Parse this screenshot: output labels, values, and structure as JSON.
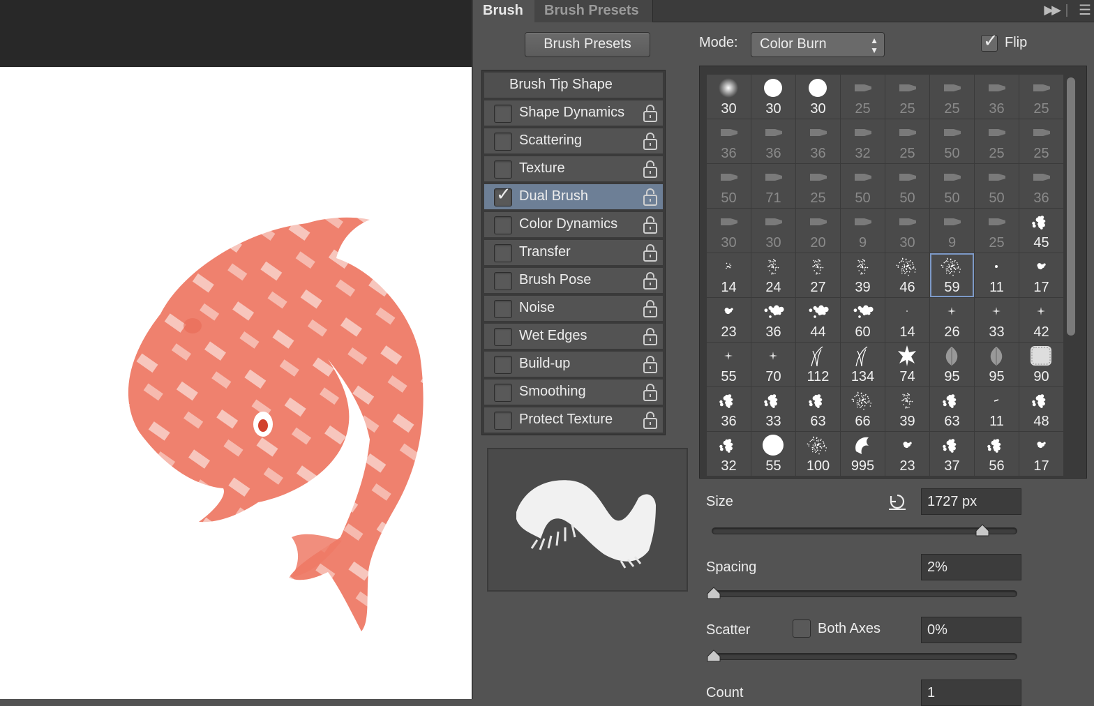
{
  "tabs": {
    "brush": "Brush",
    "brush_presets": "Brush Presets"
  },
  "toolbar": {
    "brush_presets_button": "Brush Presets",
    "mode_label": "Mode:",
    "mode_value": "Color Burn",
    "flip_label": "Flip",
    "flip_checked": true
  },
  "options": [
    {
      "label": "Brush Tip Shape",
      "header": true
    },
    {
      "label": "Shape Dynamics",
      "checked": false
    },
    {
      "label": "Scattering",
      "checked": false
    },
    {
      "label": "Texture",
      "checked": false
    },
    {
      "label": "Dual Brush",
      "checked": true,
      "active": true
    },
    {
      "label": "Color Dynamics",
      "checked": false
    },
    {
      "label": "Transfer",
      "checked": false
    },
    {
      "label": "Brush Pose",
      "checked": false
    },
    {
      "label": "Noise",
      "checked": false
    },
    {
      "label": "Wet Edges",
      "checked": false
    },
    {
      "label": "Build-up",
      "checked": false
    },
    {
      "label": "Smoothing",
      "checked": false
    },
    {
      "label": "Protect Texture",
      "checked": false
    }
  ],
  "brush_tips": [
    [
      {
        "n": "30",
        "i": "soft"
      },
      {
        "n": "30",
        "i": "hard"
      },
      {
        "n": "30",
        "i": "hard"
      },
      {
        "n": "25",
        "i": "tool",
        "d": true
      },
      {
        "n": "25",
        "i": "tool",
        "d": true
      },
      {
        "n": "25",
        "i": "tool",
        "d": true
      },
      {
        "n": "36",
        "i": "tool",
        "d": true
      },
      {
        "n": "25",
        "i": "tool",
        "d": true
      }
    ],
    [
      {
        "n": "36",
        "i": "tool",
        "d": true
      },
      {
        "n": "36",
        "i": "tool",
        "d": true
      },
      {
        "n": "36",
        "i": "tool",
        "d": true
      },
      {
        "n": "32",
        "i": "tool",
        "d": true
      },
      {
        "n": "25",
        "i": "tool",
        "d": true
      },
      {
        "n": "50",
        "i": "tool",
        "d": true
      },
      {
        "n": "25",
        "i": "tool",
        "d": true
      },
      {
        "n": "25",
        "i": "tool",
        "d": true
      }
    ],
    [
      {
        "n": "50",
        "i": "tool",
        "d": true
      },
      {
        "n": "71",
        "i": "tool",
        "d": true
      },
      {
        "n": "25",
        "i": "tool",
        "d": true
      },
      {
        "n": "50",
        "i": "tool",
        "d": true
      },
      {
        "n": "50",
        "i": "tool",
        "d": true
      },
      {
        "n": "50",
        "i": "tool",
        "d": true
      },
      {
        "n": "50",
        "i": "tool",
        "d": true
      },
      {
        "n": "36",
        "i": "tool",
        "d": true
      }
    ],
    [
      {
        "n": "30",
        "i": "tool",
        "d": true
      },
      {
        "n": "30",
        "i": "tool",
        "d": true
      },
      {
        "n": "20",
        "i": "tool",
        "d": true
      },
      {
        "n": "9",
        "i": "tool",
        "d": true
      },
      {
        "n": "30",
        "i": "tool",
        "d": true
      },
      {
        "n": "9",
        "i": "tool",
        "d": true
      },
      {
        "n": "25",
        "i": "tool",
        "d": true
      },
      {
        "n": "45",
        "i": "blob"
      }
    ],
    [
      {
        "n": "14",
        "i": "spat-s"
      },
      {
        "n": "24",
        "i": "spat"
      },
      {
        "n": "27",
        "i": "spat"
      },
      {
        "n": "39",
        "i": "spat"
      },
      {
        "n": "46",
        "i": "spat-l"
      },
      {
        "n": "59",
        "i": "spat-l",
        "sel": true
      },
      {
        "n": "11",
        "i": "dot"
      },
      {
        "n": "17",
        "i": "blob-s"
      }
    ],
    [
      {
        "n": "23",
        "i": "blob-s"
      },
      {
        "n": "36",
        "i": "chalk"
      },
      {
        "n": "44",
        "i": "chalk"
      },
      {
        "n": "60",
        "i": "chalk"
      },
      {
        "n": "14",
        "i": "dot-s"
      },
      {
        "n": "26",
        "i": "star-s"
      },
      {
        "n": "33",
        "i": "star-s"
      },
      {
        "n": "42",
        "i": "star-s"
      }
    ],
    [
      {
        "n": "55",
        "i": "star-s"
      },
      {
        "n": "70",
        "i": "star-s"
      },
      {
        "n": "112",
        "i": "grass"
      },
      {
        "n": "134",
        "i": "grass"
      },
      {
        "n": "74",
        "i": "leaf-star"
      },
      {
        "n": "95",
        "i": "leaf"
      },
      {
        "n": "95",
        "i": "leaf"
      },
      {
        "n": "90",
        "i": "texture"
      }
    ],
    [
      {
        "n": "36",
        "i": "blob"
      },
      {
        "n": "33",
        "i": "blob"
      },
      {
        "n": "63",
        "i": "blob"
      },
      {
        "n": "66",
        "i": "spat-l"
      },
      {
        "n": "39",
        "i": "spat"
      },
      {
        "n": "63",
        "i": "blob"
      },
      {
        "n": "11",
        "i": "dash"
      },
      {
        "n": "48",
        "i": "blob"
      }
    ],
    [
      {
        "n": "32",
        "i": "blob"
      },
      {
        "n": "55",
        "i": "hard-l"
      },
      {
        "n": "100",
        "i": "spat-l"
      },
      {
        "n": "995",
        "i": "dolphin"
      },
      {
        "n": "23",
        "i": "blob-s"
      },
      {
        "n": "37",
        "i": "blob"
      },
      {
        "n": "56",
        "i": "blob"
      },
      {
        "n": "17",
        "i": "blob-s"
      }
    ]
  ],
  "size": {
    "label": "Size",
    "value": "1727 px",
    "level": 0.93
  },
  "spacing": {
    "label": "Spacing",
    "value": "2%",
    "level": 0.0
  },
  "scatter": {
    "label": "Scatter",
    "both_axes_label": "Both Axes",
    "value": "0%",
    "level": 0.0
  },
  "count": {
    "label": "Count",
    "value": "1"
  },
  "colors": {
    "dolphin": "#ee7a66",
    "highlight": "#6d7f96",
    "selection": "#7d99c7"
  }
}
